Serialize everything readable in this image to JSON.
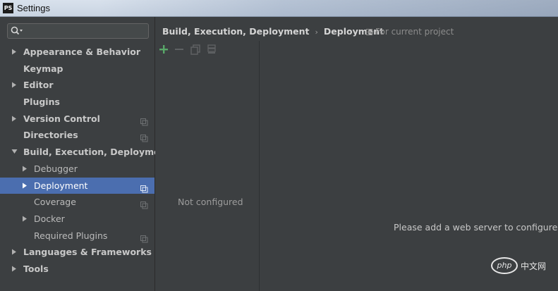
{
  "window": {
    "app_icon_text": "PS",
    "title": "Settings"
  },
  "search": {
    "value": "",
    "placeholder": ""
  },
  "sidebar": {
    "items": [
      {
        "label": "Appearance & Behavior",
        "expanded": false,
        "has_arrow": true,
        "scope_icon": false
      },
      {
        "label": "Keymap",
        "expanded": false,
        "has_arrow": false,
        "scope_icon": false
      },
      {
        "label": "Editor",
        "expanded": false,
        "has_arrow": true,
        "scope_icon": false
      },
      {
        "label": "Plugins",
        "expanded": false,
        "has_arrow": false,
        "scope_icon": false
      },
      {
        "label": "Version Control",
        "expanded": false,
        "has_arrow": true,
        "scope_icon": true
      },
      {
        "label": "Directories",
        "expanded": false,
        "has_arrow": false,
        "scope_icon": true
      },
      {
        "label": "Build, Execution, Deployment",
        "expanded": true,
        "has_arrow": true,
        "scope_icon": false,
        "children": [
          {
            "label": "Debugger",
            "has_arrow": true,
            "scope_icon": false,
            "selected": false
          },
          {
            "label": "Deployment",
            "has_arrow": true,
            "scope_icon": true,
            "selected": true
          },
          {
            "label": "Coverage",
            "has_arrow": false,
            "scope_icon": true,
            "selected": false
          },
          {
            "label": "Docker",
            "has_arrow": true,
            "scope_icon": false,
            "selected": false
          },
          {
            "label": "Required Plugins",
            "has_arrow": false,
            "scope_icon": true,
            "selected": false
          }
        ]
      },
      {
        "label": "Languages & Frameworks",
        "expanded": false,
        "has_arrow": true,
        "scope_icon": false
      },
      {
        "label": "Tools",
        "expanded": false,
        "has_arrow": true,
        "scope_icon": false
      }
    ]
  },
  "main": {
    "breadcrumb": [
      "Build, Execution, Deployment",
      "Deployment"
    ],
    "breadcrumb_separator": "›",
    "scope_label": "For current project",
    "toolbar": {
      "add_icon": "plus-icon",
      "remove_icon": "minus-icon",
      "copy_icon": "copy-icon",
      "default_icon": "server-icon"
    },
    "servers_empty_text": "Not configured",
    "details_hint": "Please add a web server to configure"
  },
  "watermark": {
    "logo_text": "php",
    "text": "中文网"
  },
  "colors": {
    "background": "#3c3f41",
    "selection": "#4b6eaf",
    "add_green": "#59a869",
    "text": "#c8c8c8"
  }
}
